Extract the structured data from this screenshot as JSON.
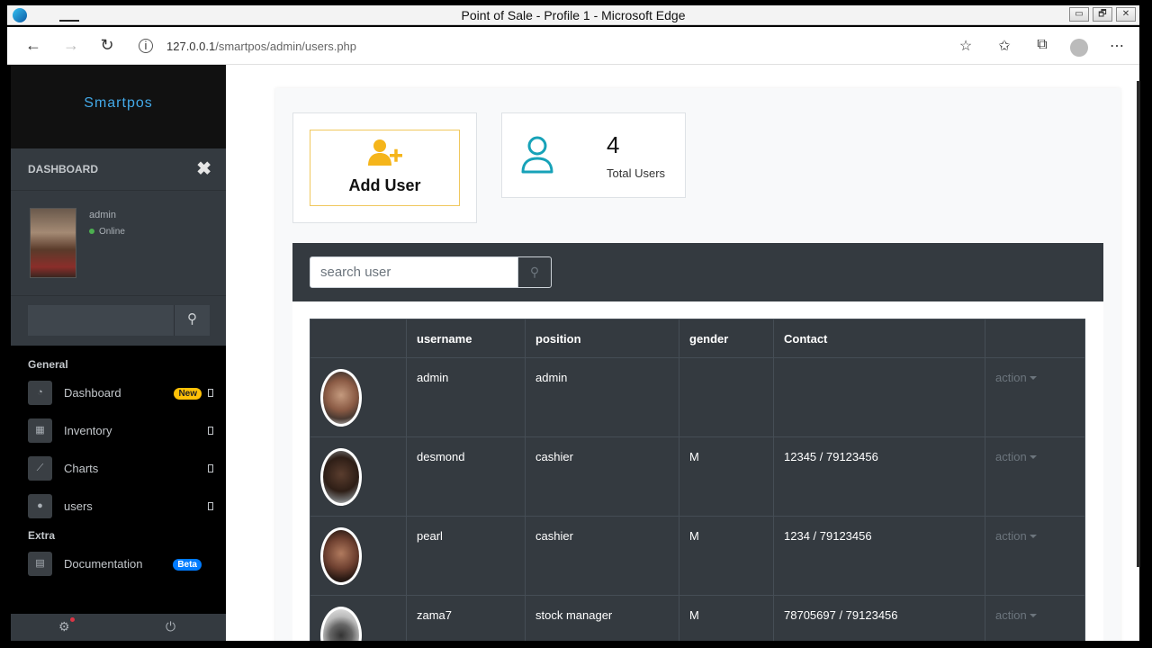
{
  "window": {
    "title": "Point of Sale - Profile 1 - Microsoft Edge",
    "buttons": [
      "▭",
      "🗗",
      "✕"
    ]
  },
  "browser": {
    "url_host": "127.0.0.1",
    "url_path": "/smartpos/admin/users.php"
  },
  "sidebar": {
    "brand": "Smartpos",
    "dashboard_label": "DASHBOARD",
    "close_symbol": "✖",
    "user": {
      "name": "admin",
      "status": "Online"
    },
    "search_placeholder": "",
    "sections": [
      {
        "title": "General",
        "items": [
          {
            "label": "Dashboard",
            "icon": "dashboard-icon",
            "badge": "New",
            "badge_color": "#ffc107"
          },
          {
            "label": "Inventory",
            "icon": "inventory-icon"
          },
          {
            "label": "Charts",
            "icon": "chart-icon"
          },
          {
            "label": "users",
            "icon": "user-icon"
          }
        ]
      },
      {
        "title": "Extra",
        "items": [
          {
            "label": "Documentation",
            "icon": "book-icon",
            "badge": "Beta",
            "badge_color": "#007bff"
          }
        ]
      }
    ]
  },
  "main": {
    "add_user_label": "Add User",
    "total_users_count": "4",
    "total_users_label": "Total Users",
    "search_placeholder": "search user",
    "table": {
      "headers": [
        "",
        "username",
        "position",
        "gender",
        "Contact",
        ""
      ],
      "rows": [
        {
          "username": "admin",
          "position": "admin",
          "gender": "",
          "contact": "",
          "action": "action"
        },
        {
          "username": "desmond",
          "position": "cashier",
          "gender": "M",
          "contact": "12345 / 79123456",
          "action": "action"
        },
        {
          "username": "pearl",
          "position": "cashier",
          "gender": "M",
          "contact": "1234 / 79123456",
          "action": "action"
        },
        {
          "username": "zama7",
          "position": "stock manager",
          "gender": "M",
          "contact": "78705697 / 79123456",
          "action": "action"
        }
      ]
    }
  },
  "colors": {
    "accent_yellow": "#f5b51b",
    "accent_teal": "#17a2b8",
    "brand_blue": "#43a9e8",
    "panel_dark": "#343a40"
  }
}
